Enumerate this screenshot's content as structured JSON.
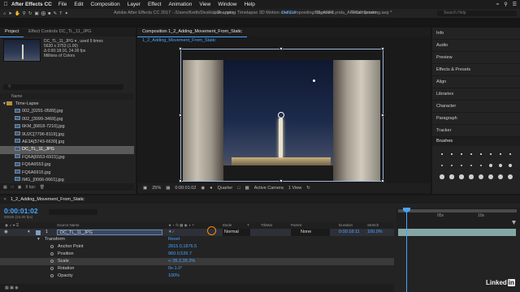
{
  "menubar": {
    "app_name": "After Effects CC",
    "items": [
      "File",
      "Edit",
      "Composition",
      "Layer",
      "Effect",
      "Animation",
      "View",
      "Window",
      "Help"
    ],
    "clock": "",
    "battery": ""
  },
  "toolbar": {
    "window_title": "Adobe After Effects CC 2017 - /Users/Keith/Desktop/A ... uru - Timelapse 3D Motion and Compositing/03_AFF/Lynda_AFFCompositing.aep *",
    "snapping_label": "Snapping",
    "workspaces": [
      "Default",
      "Standard",
      "Small Screen"
    ],
    "active_workspace": "Default",
    "search_placeholder": "Search Help"
  },
  "project_panel": {
    "tabs": [
      "Project",
      "Effect Controls DC_TL_11_JPG"
    ],
    "selected_item": "DC_TL_11_JPG ▾ , used 9 times",
    "info_lines": [
      "5630 x 3753 (1.00)",
      "Δ 0:00:18:16, 24.00 fps",
      "Millions of Colors"
    ],
    "column_name": "Name",
    "folder": "Time-Lapse",
    "items": [
      "002_[0291-0589].jpg",
      "002_[3099-3469].jpg",
      "6KM_[6818-7210].jpg",
      "9U2C[7796-8119].jpg",
      "AE3A[5743-6630].jpg",
      "DC_TL_11_JPG",
      "FQ6A[6553-6915].jpg",
      "FQ6A6553.jpg",
      "FQ6A6915.jpg",
      "IMG_[0066-0661].jpg"
    ],
    "selected_index": 5,
    "bpc": "8 bpc"
  },
  "comp_panel": {
    "tab_label": "Composition 1_2_Adding_Movement_From_Static",
    "sub_tab": "1_2_Adding_Movement_From_Static",
    "zoom": "25%",
    "timecode": "0:00:01:02",
    "resolution": "Quarter",
    "camera": "Active Camera",
    "views": "1 View"
  },
  "right_panels": {
    "items": [
      "Info",
      "Audio",
      "Preview",
      "Effects & Presets",
      "Align",
      "Libraries",
      "Character",
      "Paragraph",
      "Tracker"
    ],
    "brushes_title": "Brushes",
    "brush_sizes": [
      1,
      3,
      5,
      9,
      13,
      19,
      5,
      9,
      13,
      17,
      21,
      27,
      35,
      45,
      65,
      100
    ],
    "brush_labels": [
      "",
      "",
      "",
      "",
      "",
      "",
      "",
      "",
      "",
      "",
      "",
      "",
      "",
      "",
      "",
      "",
      "21",
      "27",
      "35",
      "45",
      "65",
      "100",
      "",
      ""
    ]
  },
  "timeline": {
    "tab_label": "1_2_Adding_Movement_From_Static",
    "timecode": "0:00:01:02",
    "fps_label": "00026 (24.00 fps)",
    "columns": {
      "source_name": "Source Name",
      "mode": "Mode",
      "t": "T",
      "trkmat": "TrkMat",
      "parent": "Parent",
      "duration": "Duration",
      "stretch": "Stretch"
    },
    "layer": {
      "number": "1",
      "name": "DC_TL_11_JPG",
      "mode": "Normal",
      "parent": "None",
      "duration": "0:00:18:11",
      "stretch": "100.0%"
    },
    "transform": {
      "label": "Transform",
      "reset": "Reset",
      "properties": [
        {
          "name": "Anchor Point",
          "value": "2815.0,1876.5"
        },
        {
          "name": "Position",
          "value": "960.0,526.7"
        },
        {
          "name": "Scale",
          "value": "∞ 35.2,35.2%"
        },
        {
          "name": "Rotation",
          "value": "0x-1.0°"
        },
        {
          "name": "Opacity",
          "value": "100%"
        }
      ],
      "highlighted_index": 2
    },
    "ruler_labels": [
      "05s",
      "10s"
    ],
    "watermark": "Linked",
    "watermark_in": "in"
  }
}
